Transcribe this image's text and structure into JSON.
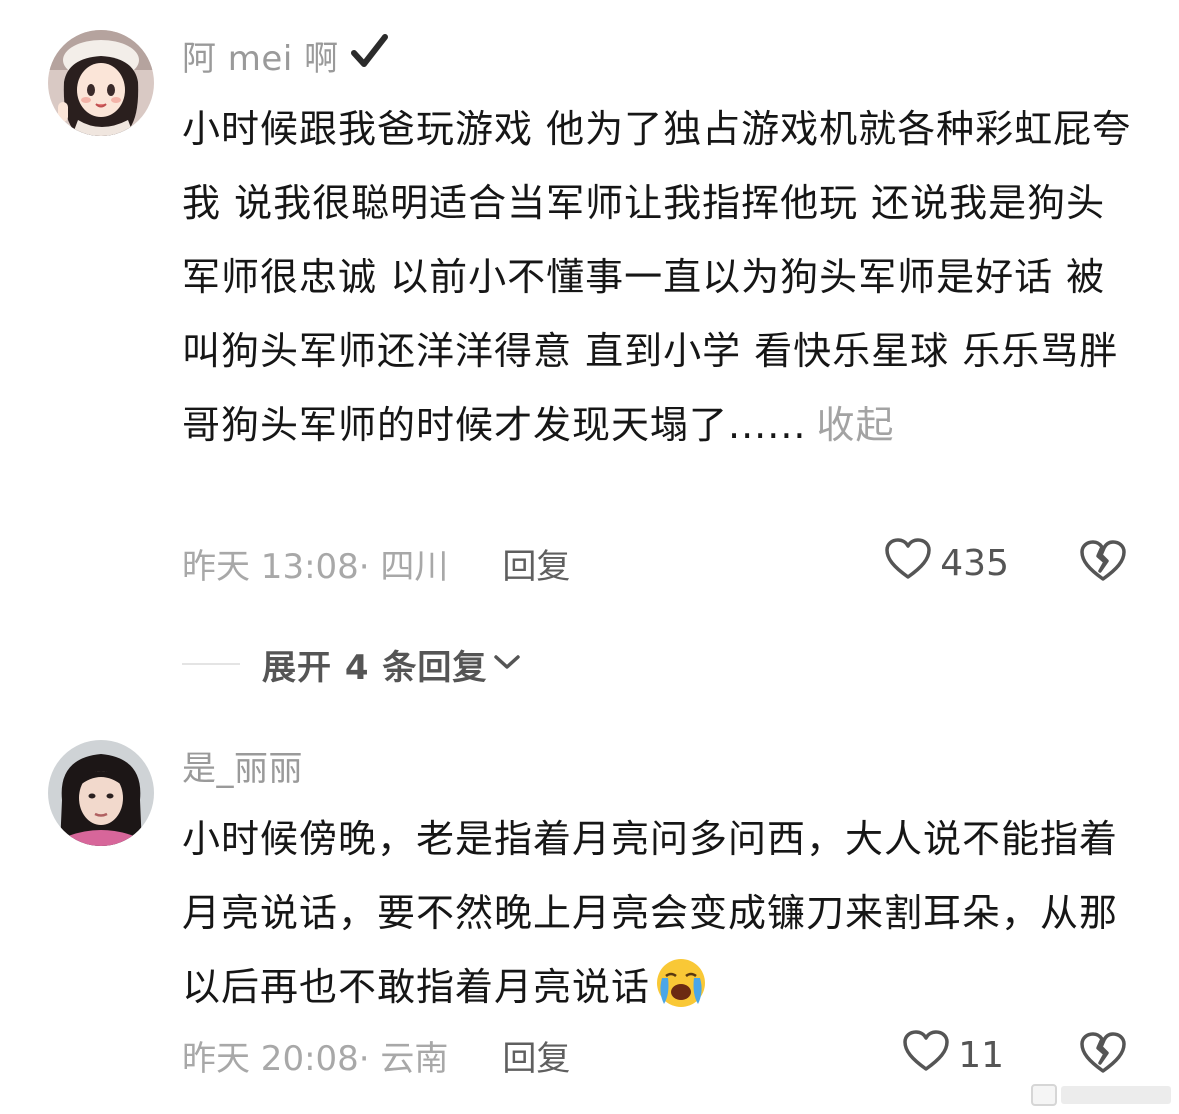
{
  "comments": [
    {
      "username": "阿 mei 啊",
      "text": "小时候跟我爸玩游戏 他为了独占游戏机就各种彩虹屁夸我 说我很聪明适合当军师让我指挥他玩 还说我是狗头军师很忠诚 以前小不懂事一直以为狗头军师是好话 被叫狗头军师还洋洋得意  直到小学 看快乐星球 乐乐骂胖哥狗头军师的时候才发现天塌了......",
      "collapse_label": "收起",
      "meta": "昨天 13:08· 四川",
      "reply_label": "回复",
      "likes": "435",
      "verified": true
    },
    {
      "username": "是_丽丽",
      "text": "小时候傍晚，老是指着月亮问多问西，大人说不能指着月亮说话，要不然晚上月亮会变成镰刀来割耳朵，从那以后再也不敢指着月亮说话",
      "emoji": "loudly-crying-face",
      "meta": "昨天 20:08· 云南",
      "reply_label": "回复",
      "likes": "11"
    }
  ],
  "expand_replies_label": "展开 4 条回复",
  "colors": {
    "meta_gray": "#a8a8a8",
    "text": "#161616",
    "username_gray": "#9a9a9a"
  }
}
